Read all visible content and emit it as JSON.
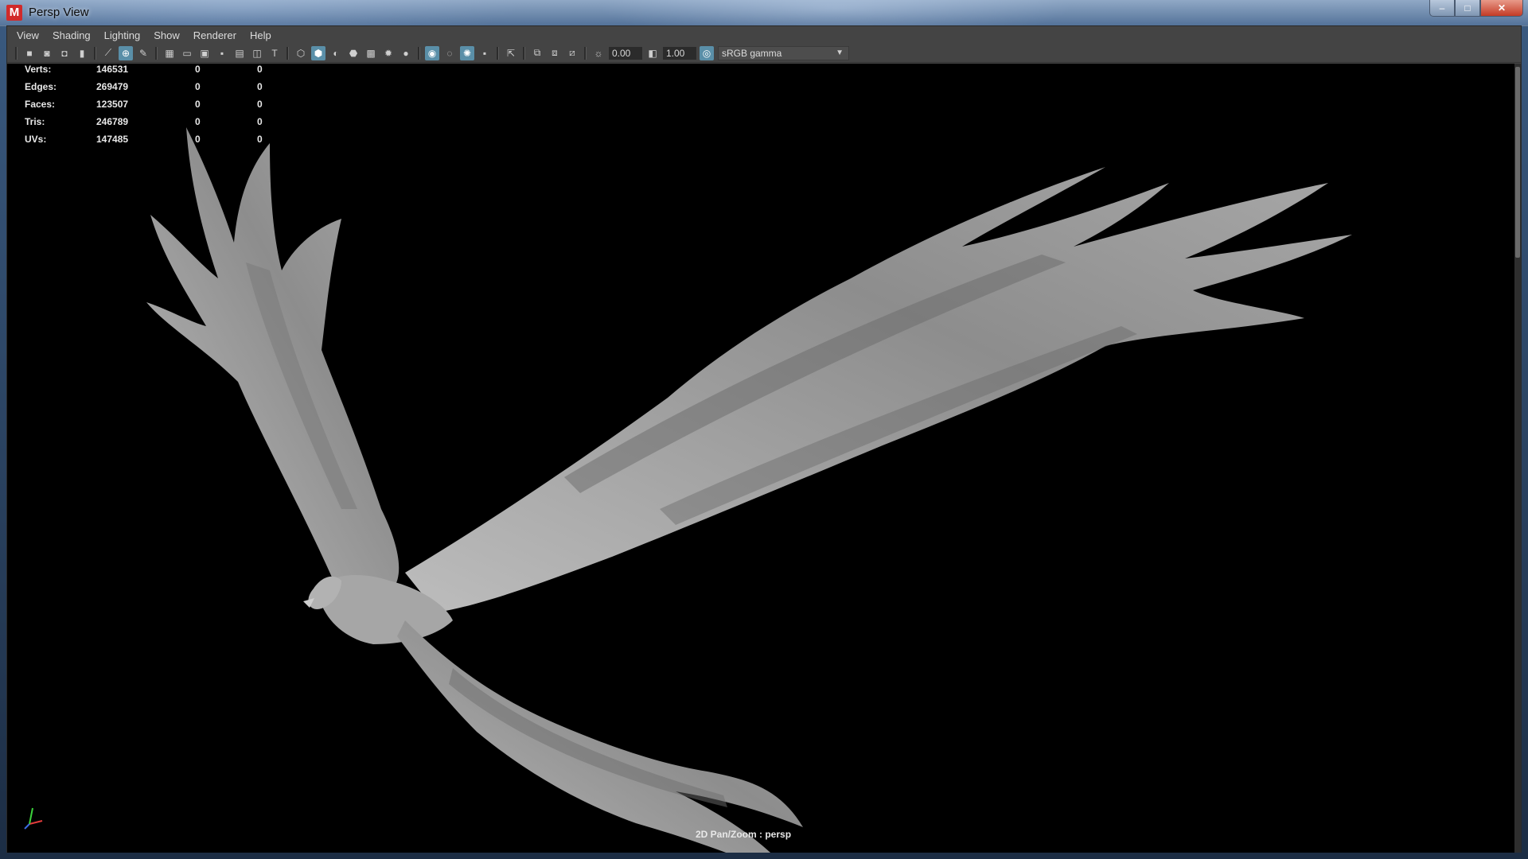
{
  "window": {
    "title": "Persp View",
    "app_icon": "M",
    "controls": {
      "minimize": "‒",
      "maximize": "□",
      "close": "✕"
    }
  },
  "menu": [
    "View",
    "Shading",
    "Lighting",
    "Show",
    "Renderer",
    "Help"
  ],
  "toolbar": {
    "exposure_value": "0.00",
    "gamma_value": "1.00",
    "color_space": "sRGB gamma"
  },
  "hud_stats": [
    {
      "label": "Verts:",
      "v1": "146531",
      "v2": "0",
      "v3": "0"
    },
    {
      "label": "Edges:",
      "v1": "269479",
      "v2": "0",
      "v3": "0"
    },
    {
      "label": "Faces:",
      "v1": "123507",
      "v2": "0",
      "v3": "0"
    },
    {
      "label": "Tris:",
      "v1": "246789",
      "v2": "0",
      "v3": "0"
    },
    {
      "label": "UVs:",
      "v1": "147485",
      "v2": "0",
      "v3": "0"
    }
  ],
  "viewport": {
    "camera_status": "2D Pan/Zoom : persp",
    "model": "phoenix-bird-model"
  },
  "colors": {
    "panel": "#444444",
    "viewport_bg": "#000000",
    "active_icon": "#5a8fa8",
    "model_gray": "#9a9a9a"
  }
}
